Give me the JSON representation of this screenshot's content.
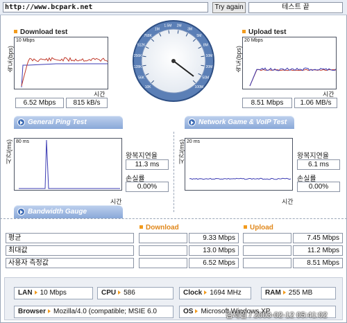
{
  "address": "http://www.bcpark.net",
  "retry_label": "Try again",
  "status_text": "테스트 끝",
  "download": {
    "title": "Download test",
    "axis_label": "속도(bps)",
    "scale": "10 Mbps",
    "time_label": "시간",
    "speed": "6.52 Mbps",
    "rate": "815 kB/s"
  },
  "upload": {
    "title": "Upload test",
    "axis_label": "속도(bps)",
    "scale": "20 Mbps",
    "time_label": "시간",
    "speed": "8.51 Mbps",
    "rate": "1.06 MB/s"
  },
  "tabs": {
    "ping": "General Ping Test",
    "game": "Network Game & VoIP Test",
    "bandwidth": "Bandwidth Gauge"
  },
  "ping": {
    "axis_label": "시간(ms)",
    "scale": "80 ms",
    "time_label": "시간",
    "latency_label": "왕복지연율",
    "latency": "11.3 ms",
    "loss_label": "손실률",
    "loss": "0.00%"
  },
  "game": {
    "axis_label": "시간(ms)",
    "scale": "20 ms",
    "time_label": "시간",
    "latency_label": "왕복지연율",
    "latency": "6.1 ms",
    "loss_label": "손실률",
    "loss": "0.00%"
  },
  "gauge_ticks": [
    "10K",
    "56K",
    "128K",
    "256K",
    "512K",
    "768K",
    "1M",
    "1.5M",
    "2M",
    "3M",
    "5M",
    "8M",
    "10M",
    "20M",
    "50M",
    "100M"
  ],
  "bandwidth": {
    "download_header": "Download",
    "upload_header": "Upload",
    "rows": [
      {
        "label": "평균",
        "download": "9.33 Mbps",
        "upload": "7.45 Mbps"
      },
      {
        "label": "최대값",
        "download": "13.0 Mbps",
        "upload": "11.2 Mbps"
      },
      {
        "label": "사용자 측정값",
        "download": "6.52 Mbps",
        "upload": "8.51 Mbps"
      }
    ]
  },
  "system": {
    "lan_label": "LAN",
    "lan": "10 Mbps",
    "cpu_label": "CPU",
    "cpu": "586",
    "clock_label": "Clock",
    "clock": "1694 MHz",
    "ram_label": "RAM",
    "ram": "255 MB",
    "browser_label": "Browser",
    "browser": "Mozilla/4.0 (compatible; MSIE 6.0",
    "os_label": "OS",
    "os": "Microsoft Windows XP"
  },
  "watermark": "김세일 / 2003-02-12 05:41:02",
  "colors": {
    "accent": "#f29b1d",
    "tab": "#89a8d8",
    "download_line": "#c0392b",
    "upload_line": "#3b3bb3"
  }
}
